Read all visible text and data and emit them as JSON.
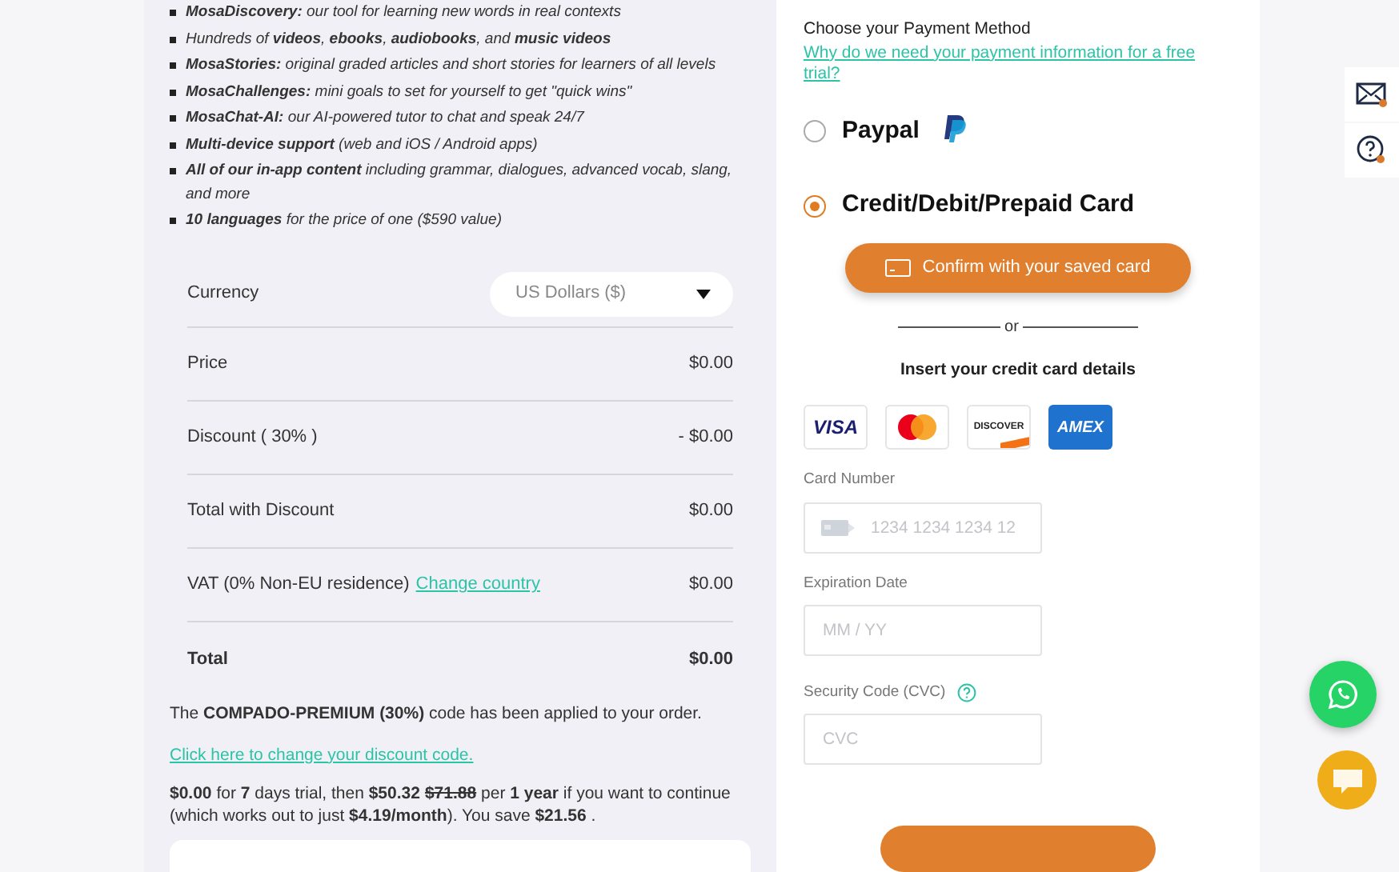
{
  "features": [
    {
      "text": "**MosaDiscovery:** our tool for learning new words in real contexts"
    },
    {
      "text": "Hundreds of **videos**, **ebooks**, **audiobooks**, and **music videos**"
    },
    {
      "text": "**MosaStories:** original graded articles and short stories for learners of all levels"
    },
    {
      "text": "**MosaChallenges:** mini goals to set for yourself to get \"quick wins\""
    },
    {
      "text": "**MosaChat-AI:** our AI-powered tutor to chat and speak 24/7"
    },
    {
      "text": "**Multi-device support** (web and iOS / Android apps)"
    },
    {
      "text": "**All of our in-app content** including grammar, dialogues, advanced vocab, slang, and more"
    },
    {
      "text": "**10 languages** for the price of one ($590 value)"
    }
  ],
  "currency": {
    "label": "Currency",
    "value": "US Dollars ($)"
  },
  "summary_rows": [
    {
      "kind": "plain",
      "label": "Price",
      "value": "$0.00"
    },
    {
      "kind": "plain",
      "label": "Discount ( 30% )",
      "value": "- $0.00"
    },
    {
      "kind": "plain",
      "label": "Total with Discount",
      "value": "$0.00"
    },
    {
      "kind": "link",
      "label": "VAT (0% Non-EU residence)",
      "link": "Change country",
      "value": "$0.00"
    },
    {
      "kind": "total",
      "label": "Total",
      "value": "$0.00"
    }
  ],
  "promo": {
    "notice": "The **COMPADO-PREMIUM (30%)** code has been applied to your order.",
    "change_link": "Click here to change your discount code.",
    "trial_text": [
      {
        "kind": "bold",
        "text": "$0.00"
      },
      {
        "kind": "plain",
        "text": " for "
      },
      {
        "kind": "bold",
        "text": "7"
      },
      {
        "kind": "plain",
        "text": " days trial, then "
      },
      {
        "kind": "bold",
        "text": "$50.32"
      },
      {
        "kind": "strike",
        "text": "$71.88"
      },
      {
        "kind": "plain",
        "text": " per "
      },
      {
        "kind": "bold",
        "text": "1 year"
      },
      {
        "kind": "plain",
        "text": " if you want to continue (which works out to just "
      },
      {
        "kind": "bold",
        "text": "$4.19/month"
      },
      {
        "kind": "plain",
        "text": "). You save "
      },
      {
        "kind": "bold",
        "text": "$21.56"
      },
      {
        "kind": "plain",
        "text": " ."
      }
    ]
  },
  "payment": {
    "heading": "Choose your Payment Method",
    "why_link": "Why do we need your payment information for a free trial?",
    "methods": [
      {
        "kind": "paypal",
        "label": "Paypal",
        "selected": false
      },
      {
        "kind": "card",
        "label": "Credit/Debit/Prepaid Card",
        "selected": true
      }
    ],
    "saved_card_button": "Confirm with your saved card",
    "separator": "or",
    "insert_heading": "Insert your credit card details",
    "card_brands": [
      {
        "kind": "visa",
        "label": "VISA"
      },
      {
        "kind": "mastercard"
      },
      {
        "kind": "discover",
        "label": "DISCOVER"
      },
      {
        "kind": "amex",
        "label": "AMEX"
      }
    ],
    "fields": [
      {
        "kind": "card",
        "label": "Card Number",
        "placeholder": "1234 1234 1234 12"
      },
      {
        "kind": "plain",
        "label": "Expiration Date",
        "placeholder": "MM / YY"
      },
      {
        "kind": "help",
        "label": "Security Code (CVC)",
        "placeholder": "CVC"
      }
    ]
  }
}
